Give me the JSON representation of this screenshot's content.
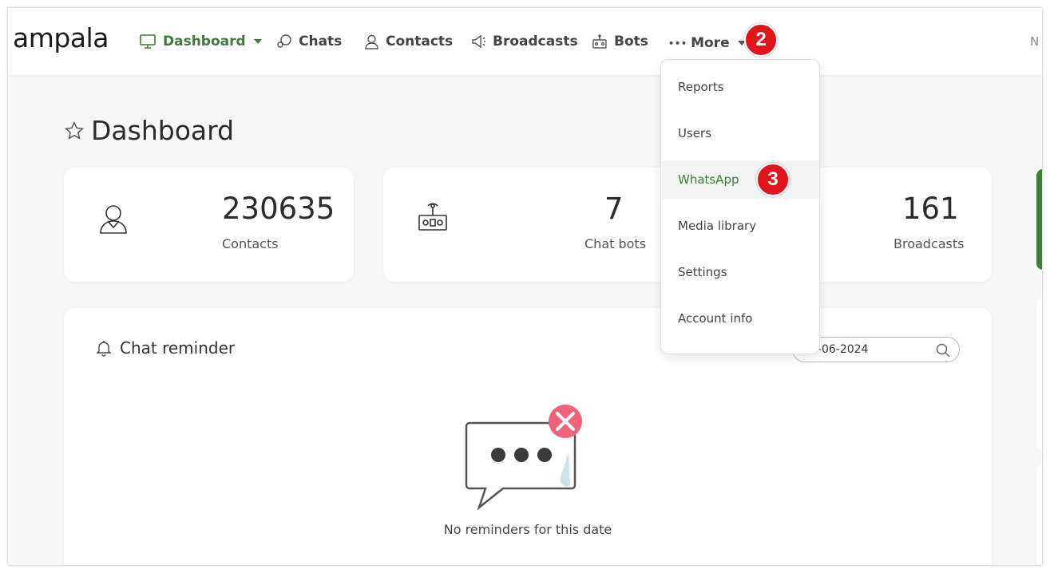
{
  "brand": {
    "logo_text": "ampala"
  },
  "nav": {
    "dashboard": {
      "label": "Dashboard",
      "icon": "monitor-icon"
    },
    "chats": {
      "label": "Chats",
      "icon": "chat-bubble-icon"
    },
    "contacts": {
      "label": "Contacts",
      "icon": "contact-icon"
    },
    "broadcasts": {
      "label": "Broadcasts",
      "icon": "megaphone-icon"
    },
    "bots": {
      "label": "Bots",
      "icon": "robot-icon"
    },
    "more": {
      "label": "More",
      "dots": "•••"
    },
    "right_text": "N"
  },
  "more_menu": {
    "items": [
      "Reports",
      "Users",
      "WhatsApp",
      "Media library",
      "Settings",
      "Account info"
    ],
    "hovered": "WhatsApp"
  },
  "annotations": {
    "step2": "2",
    "step3": "3",
    "badge_color": "#e0151b"
  },
  "page": {
    "title": "Dashboard"
  },
  "stats": {
    "contacts": {
      "value": "230635",
      "label": "Contacts"
    },
    "bots": {
      "value": "7",
      "label": "Chat bots"
    },
    "broadcasts": {
      "value": "161",
      "label": "Broadcasts"
    }
  },
  "reminder": {
    "title": "Chat reminder",
    "date_value": "3-06-2024",
    "empty_message": "No reminders for this date"
  },
  "colors": {
    "accent": "#3f7b3b",
    "alert": "#f0647a"
  }
}
